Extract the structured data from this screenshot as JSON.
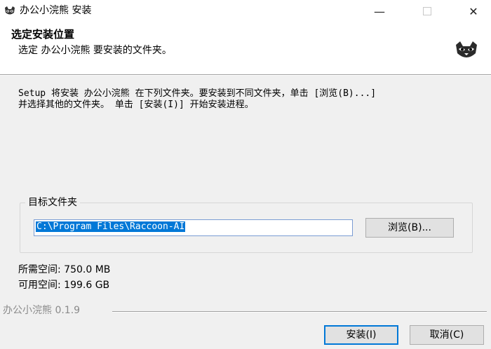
{
  "window": {
    "title": "办公小浣熊 安装",
    "minimize_glyph": "—",
    "close_glyph": "✕",
    "icon": "raccoon-icon"
  },
  "header": {
    "title": "选定安装位置",
    "subtitle": "选定 办公小浣熊 要安装的文件夹。",
    "logo": "raccoon-logo"
  },
  "body": {
    "intro": "Setup 将安装 办公小浣熊 在下列文件夹。要安装到不同文件夹，单击 [浏览(B)...]\n并选择其他的文件夹。 单击 [安装(I)] 开始安装进程。",
    "group_label": "目标文件夹",
    "install_dir": "C:\\Program Files\\Raccoon-AI",
    "browse_label": "浏览(B)...",
    "space_required": "所需空间: 750.0 MB",
    "space_available": "可用空间: 199.6 GB"
  },
  "footer": {
    "brand": "办公小浣熊 0.1.9",
    "install_label": "安装(I)",
    "cancel_label": "取消(C)"
  },
  "colors": {
    "panel_bg": "#f0f0f0",
    "accent": "#0078d7"
  }
}
